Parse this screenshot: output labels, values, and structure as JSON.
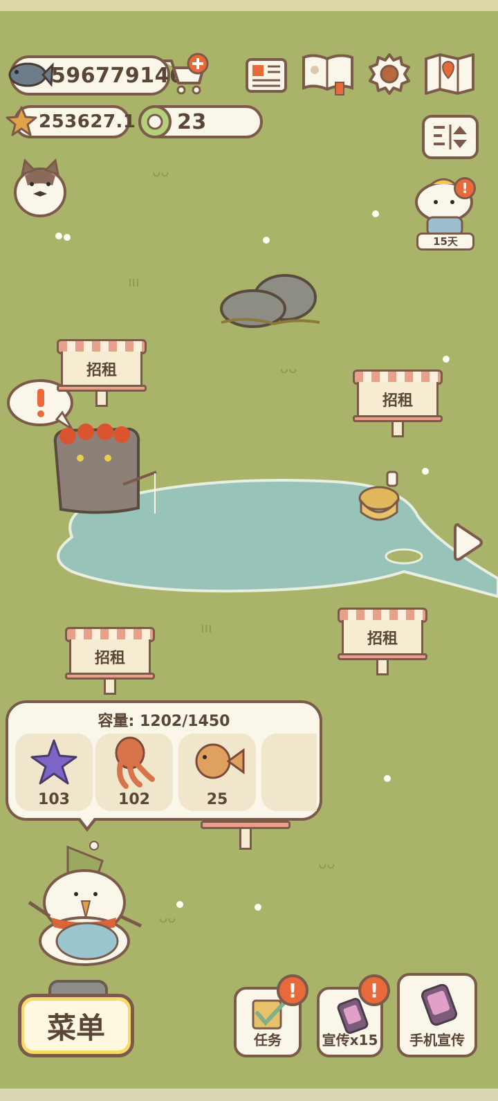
{
  "currency": {
    "fish_amount": "596779146",
    "star_amount": "253627.1",
    "ring_amount": "23"
  },
  "event": {
    "days_label": "15天"
  },
  "signs": {
    "rent_1": "招租",
    "rent_2": "招租",
    "rent_3": "招租",
    "rent_4": "招租"
  },
  "inventory": {
    "capacity_label": "容量: 1202/1450",
    "items": [
      {
        "name": "starfish",
        "count": "103"
      },
      {
        "name": "octopus",
        "count": "102"
      },
      {
        "name": "pufferfish",
        "count": "25"
      }
    ]
  },
  "buttons": {
    "menu_label": "菜单",
    "task_label": "任务",
    "promo_label": "宣传x15",
    "phone_promo_label": "手机宣传",
    "alert_mark": "!"
  },
  "colors": {
    "grass": "#aab36a",
    "pond": "#97c3b8",
    "outline": "#7b5a4a",
    "panel": "#fbf6ea",
    "badge": "#e86a3a",
    "menu_button": "#f7d96c"
  }
}
